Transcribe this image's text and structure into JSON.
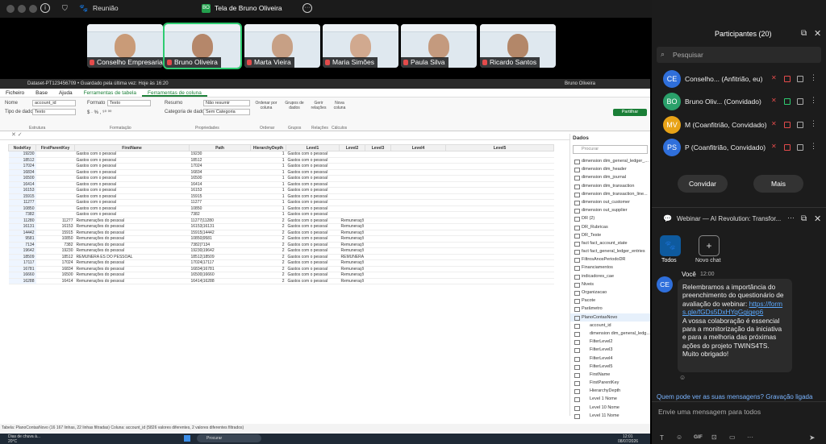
{
  "topbar": {
    "meeting": "Reunião",
    "share_title": "Tela de Bruno Oliveira",
    "more": "···"
  },
  "participants_tiles": [
    {
      "name": "Conselho Empresarial..."
    },
    {
      "name": "Bruno Oliveira"
    },
    {
      "name": "Marta Vieira"
    },
    {
      "name": "Maria Simões"
    },
    {
      "name": "Paula Silva"
    },
    {
      "name": "Ricardo Santos"
    }
  ],
  "pbi": {
    "title": "Dataset-PT123456709 • Guardado pela última vez: Hoje às 16:20",
    "user": "Bruno Oliveira",
    "menu": [
      "Ficheiro",
      "Base",
      "Ajuda",
      "Ferramentas de tabela",
      "Ferramentas de coluna"
    ],
    "share": "Partilhar",
    "ribbon": {
      "name_lbl": "Nome",
      "name_val": "account_id",
      "type_lbl": "Tipo de dados",
      "type_val": "Texto",
      "format_lbl": "Formato",
      "format_val": "Texto",
      "summ_lbl": "Resumo",
      "summ_val": "Não resumir",
      "cat_lbl": "Categoria de dados",
      "cat_val": "Sem Categoria",
      "sort_lbl": "Ordenar por coluna",
      "groups_lbl": "Grupos de dados",
      "rel_lbl": "Gerir relações",
      "newcol_lbl": "Nova coluna",
      "grp_struct": "Estrutura",
      "grp_fmt": "Formatação",
      "grp_props": "Propriedades",
      "grp_sort": "Ordenar",
      "grp_groups": "Grupos",
      "grp_rel": "Relações",
      "grp_calc": "Cálculos"
    },
    "columns": [
      "NodeKey",
      "FirstParentKey",
      "FirstName",
      "Path",
      "HierarchyDepth",
      "Level1",
      "Level2",
      "Level3",
      "Level4",
      "Level5"
    ],
    "rows": [
      [
        "19230",
        "",
        "Gastos com o pessoal",
        "19230",
        "1",
        "Gastos com o pessoal",
        "",
        "",
        "",
        ""
      ],
      [
        "18512",
        "",
        "Gastos com o pessoal",
        "18512",
        "1",
        "Gastos com o pessoal",
        "",
        "",
        "",
        ""
      ],
      [
        "17024",
        "",
        "Gastos com o pessoal",
        "17024",
        "1",
        "Gastos com o pessoal",
        "",
        "",
        "",
        ""
      ],
      [
        "16834",
        "",
        "Gastos com o pessoal",
        "16834",
        "1",
        "Gastos com o pessoal",
        "",
        "",
        "",
        ""
      ],
      [
        "16500",
        "",
        "Gastos com o pessoal",
        "16500",
        "1",
        "Gastos com o pessoal",
        "",
        "",
        "",
        ""
      ],
      [
        "16414",
        "",
        "Gastos com o pessoal",
        "16414",
        "1",
        "Gastos com o pessoal",
        "",
        "",
        "",
        ""
      ],
      [
        "16153",
        "",
        "Gastos com o pessoal",
        "16153",
        "1",
        "Gastos com o pessoal",
        "",
        "",
        "",
        ""
      ],
      [
        "15915",
        "",
        "Gastos com o pessoal",
        "15915",
        "1",
        "Gastos com o pessoal",
        "",
        "",
        "",
        ""
      ],
      [
        "11277",
        "",
        "Gastos com o pessoal",
        "11277",
        "1",
        "Gastos com o pessoal",
        "",
        "",
        "",
        ""
      ],
      [
        "10850",
        "",
        "Gastos com o pessoal",
        "10850",
        "1",
        "Gastos com o pessoal",
        "",
        "",
        "",
        ""
      ],
      [
        "7382",
        "",
        "Gastos com o pessoal",
        "7382",
        "1",
        "Gastos com o pessoal",
        "",
        "",
        "",
        ""
      ],
      [
        "11280",
        "11277",
        "Remunerações do pessoal",
        "11277|11280",
        "2",
        "Gastos com o pessoal",
        "Remuneraçõ",
        "",
        "",
        ""
      ],
      [
        "16131",
        "16153",
        "Remunerações do pessoal",
        "16153|16131",
        "2",
        "Gastos com o pessoal",
        "Remuneraçõ",
        "",
        "",
        ""
      ],
      [
        "14442",
        "15915",
        "Remunerações do pessoal",
        "15915|14442",
        "2",
        "Gastos com o pessoal",
        "Remuneraçõ",
        "",
        "",
        ""
      ],
      [
        "9581",
        "10850",
        "Remunerações do pessoal",
        "10850|9581",
        "2",
        "Gastos com o pessoal",
        "Remuneraçõ",
        "",
        "",
        ""
      ],
      [
        "7134",
        "7382",
        "Remunerações do pessoal",
        "7382|7134",
        "2",
        "Gastos com o pessoal",
        "Remuneraçõ",
        "",
        "",
        ""
      ],
      [
        "19642",
        "19230",
        "Remunerações do pessoal",
        "19230|19642",
        "2",
        "Gastos com o pessoal",
        "Remuneraçõ",
        "",
        "",
        ""
      ],
      [
        "18509",
        "18512",
        "REMUNERA ES DO PESSOAL",
        "18512|18509",
        "2",
        "Gastos com o pessoal",
        "REMUNERA",
        "",
        "",
        ""
      ],
      [
        "17117",
        "17024",
        "Remunerações do pessoal",
        "17024|17117",
        "2",
        "Gastos com o pessoal",
        "Remuneraçõ",
        "",
        "",
        ""
      ],
      [
        "16781",
        "16834",
        "Remunerações do pessoal",
        "16834|16781",
        "2",
        "Gastos com o pessoal",
        "Remuneraçõ",
        "",
        "",
        ""
      ],
      [
        "16660",
        "16500",
        "Remunerações do pessoal",
        "16500|16660",
        "2",
        "Gastos com o pessoal",
        "Remuneraçõ",
        "",
        "",
        ""
      ],
      [
        "16288",
        "16414",
        "Remunerações do pessoal",
        "16414|16288",
        "2",
        "Gastos com o pessoal",
        "Remuneraçõ",
        "",
        "",
        ""
      ]
    ],
    "data_title": "Dados",
    "data_search": "Procurar",
    "data_items": [
      "dimension dim_general_ledger_...",
      "dimension dim_header",
      "dimension dim_journal",
      "dimension dim_transaction",
      "dimension dim_transaction_line...",
      "dimension out_customer",
      "dimension out_supplier",
      "DR (2)",
      "DR_Rubricas",
      "DR_Teste",
      "fact fact_account_state",
      "fact fact_general_ledger_entries",
      "FiltrosAnosPeriodoDR",
      "Financiamentos",
      "indicadores_cae",
      "Niveis",
      "Organizacao",
      "Pacote",
      "Parâmetro",
      "PlanoContasNovo",
      "account_id",
      "dimension dim_general_ledg...",
      "FilterLevel2",
      "FilterLevel3",
      "FilterLevel4",
      "FilterLevel5",
      "FirstName",
      "FirstParentKey",
      "HierarchyDepth",
      "Level 1 Nome",
      "Level 10 Nome",
      "Level 11 Nome"
    ],
    "status": "Tabela: PlanoContasNovo (16 167 linhas, 22 linhas filtradas) Coluna: account_id (5826 valores diferentes, 2 valores diferentes filtrados)",
    "taskbar": {
      "weather": "Dias de chuva à...",
      "temp": "20°C",
      "search": "Procurar",
      "time": "12:01",
      "date": "08/07/2026"
    }
  },
  "panel": {
    "title": "Participantes (20)",
    "search": "Pesquisar",
    "people": [
      {
        "initials": "CE",
        "name": "Conselho...",
        "role": "(Anfitrião, eu)",
        "color": "#2f6fdb"
      },
      {
        "initials": "BO",
        "name": "Bruno Oliv...",
        "role": "(Convidado)",
        "color": "#2aa06a"
      },
      {
        "initials": "MV",
        "name": "M",
        "role": "(Coanfitrião, Convidado)",
        "color": "#e8a317"
      },
      {
        "initials": "PS",
        "name": "P",
        "role": "(Coanfitrião, Convidado)",
        "color": "#2f6fdb"
      }
    ],
    "invite": "Convidar",
    "more": "Mais",
    "chat_title": "Webinar — AI Revolution: Transfor...",
    "all": "Todos",
    "new_chat": "Novo chat",
    "msg_author": "Você",
    "msg_time": "12:00",
    "msg_avatar": "CE",
    "msg_text1": "Relembramos a importância do preenchimento do questionário de avaliação do webinar: ",
    "msg_link": "https://forms.gle/fGDs5DxHYqGgigep6",
    "msg_text2": "A vossa colaboração é essencial para a monitorização da iniciativa e para a melhoria das próximas ações do projeto TWINS4TS.",
    "msg_text3": "Muito obrigado!",
    "who_can_see": "Quem pode ver as suas mensagens? Gravação ligada",
    "input_placeholder": "Envie uma mensagem para todos",
    "gif": "GIF"
  }
}
